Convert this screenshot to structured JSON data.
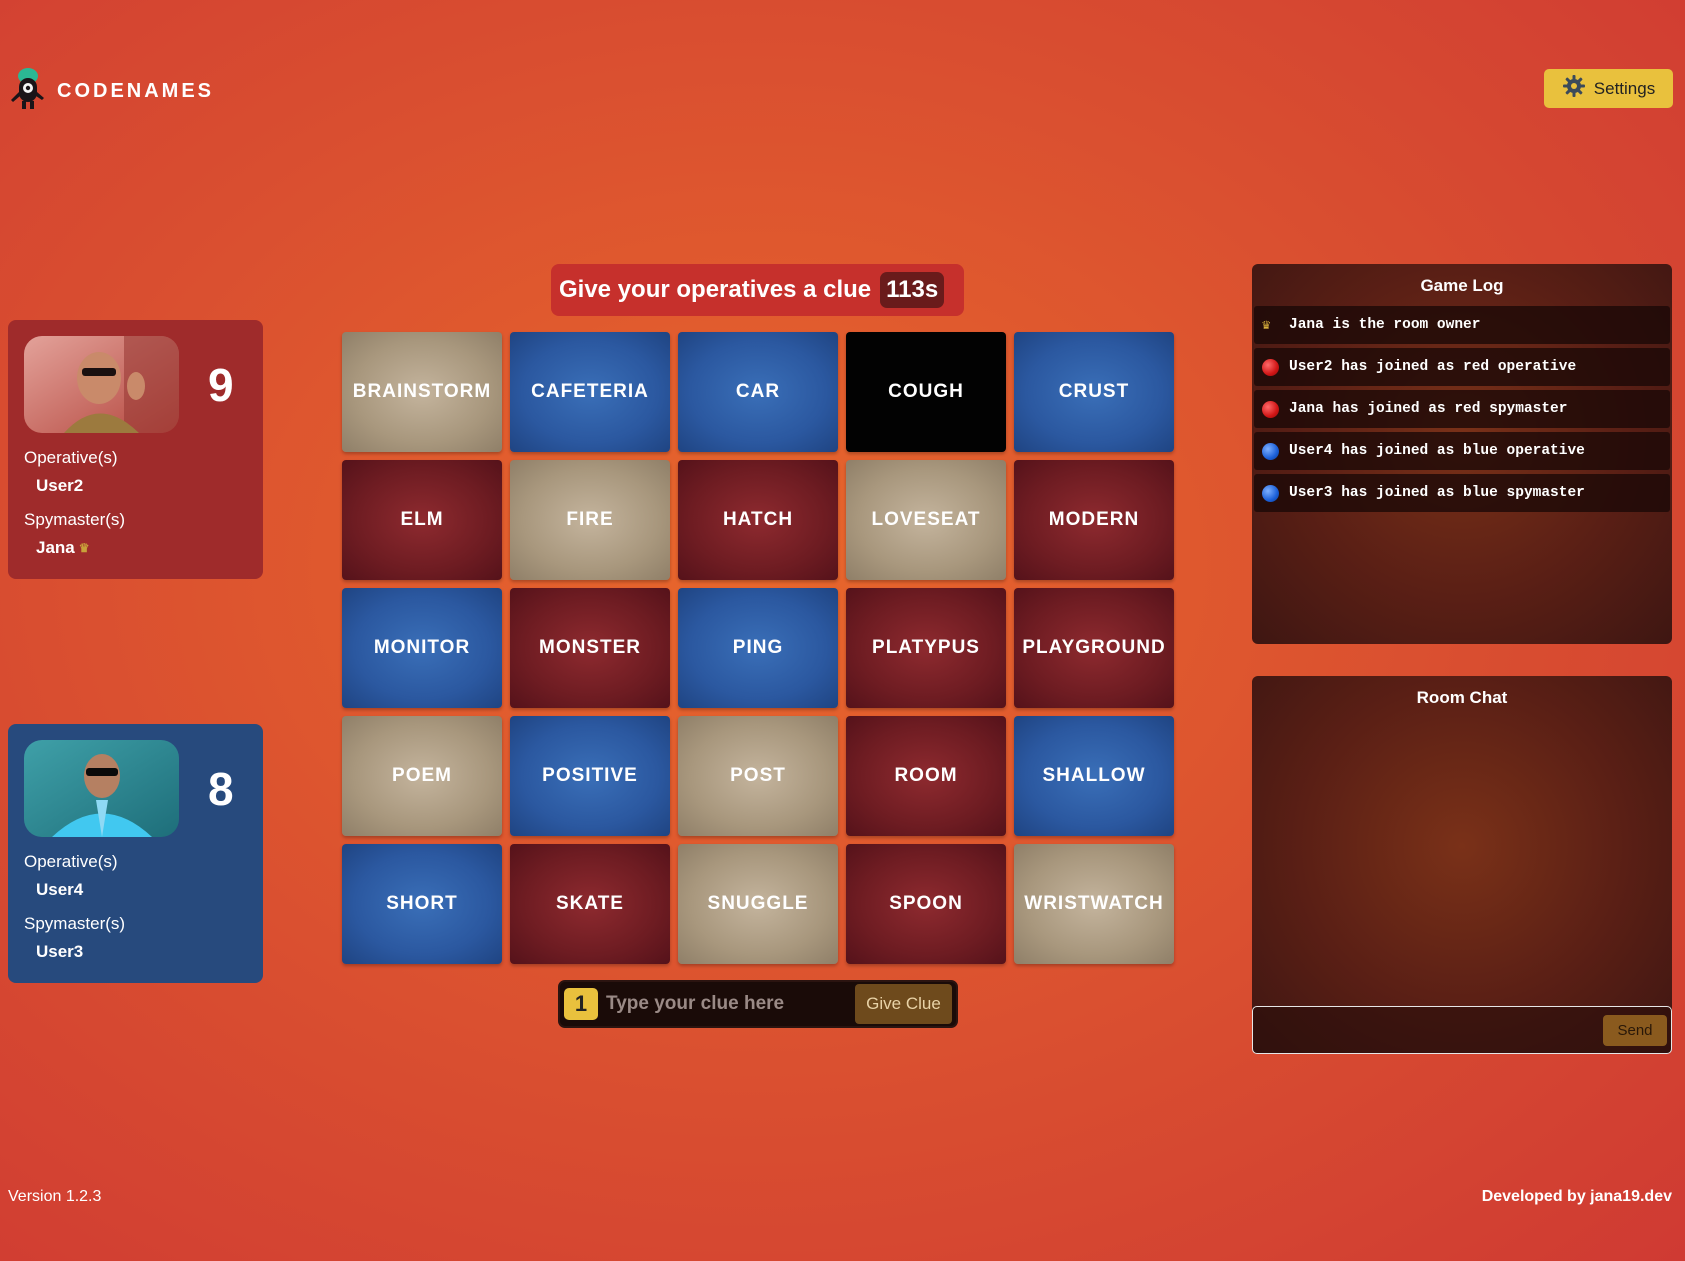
{
  "app": {
    "logo_text": "CODENAMES",
    "settings_label": "Settings"
  },
  "teams": {
    "red": {
      "score": "9",
      "operatives_label": "Operative(s)",
      "operatives": [
        "User2"
      ],
      "spymasters_label": "Spymaster(s)",
      "spymasters": [
        "Jana"
      ],
      "owner_badge_icon": "crown-icon",
      "color": "#9f2b2b"
    },
    "blue": {
      "score": "8",
      "operatives_label": "Operative(s)",
      "operatives": [
        "User4"
      ],
      "spymasters_label": "Spymaster(s)",
      "spymasters": [
        "User3"
      ],
      "color": "#274a7d"
    }
  },
  "turn": {
    "message": "Give your operatives a clue",
    "timer": "113s"
  },
  "board": {
    "cards": [
      {
        "word": "BRAINSTORM",
        "type": "neutral"
      },
      {
        "word": "CAFETERIA",
        "type": "blue"
      },
      {
        "word": "CAR",
        "type": "blue"
      },
      {
        "word": "COUGH",
        "type": "assassin"
      },
      {
        "word": "CRUST",
        "type": "blue"
      },
      {
        "word": "ELM",
        "type": "red"
      },
      {
        "word": "FIRE",
        "type": "neutral"
      },
      {
        "word": "HATCH",
        "type": "red"
      },
      {
        "word": "LOVESEAT",
        "type": "neutral"
      },
      {
        "word": "MODERN",
        "type": "red"
      },
      {
        "word": "MONITOR",
        "type": "blue"
      },
      {
        "word": "MONSTER",
        "type": "red"
      },
      {
        "word": "PING",
        "type": "blue"
      },
      {
        "word": "PLATYPUS",
        "type": "red"
      },
      {
        "word": "PLAYGROUND",
        "type": "red"
      },
      {
        "word": "POEM",
        "type": "neutral"
      },
      {
        "word": "POSITIVE",
        "type": "blue"
      },
      {
        "word": "POST",
        "type": "neutral"
      },
      {
        "word": "ROOM",
        "type": "red"
      },
      {
        "word": "SHALLOW",
        "type": "blue"
      },
      {
        "word": "SHORT",
        "type": "blue"
      },
      {
        "word": "SKATE",
        "type": "red"
      },
      {
        "word": "SNUGGLE",
        "type": "neutral"
      },
      {
        "word": "SPOON",
        "type": "red"
      },
      {
        "word": "WRISTWATCH",
        "type": "neutral"
      }
    ]
  },
  "clue": {
    "count": "1",
    "placeholder": "Type your clue here",
    "button_label": "Give Clue"
  },
  "game_log": {
    "title": "Game Log",
    "entries": [
      {
        "icon": "crown-icon",
        "text": "Jana is the room owner"
      },
      {
        "icon": "red-dot-icon",
        "text": "User2 has joined as red operative"
      },
      {
        "icon": "red-dot-icon",
        "text": "Jana has joined as red spymaster"
      },
      {
        "icon": "blue-dot-icon",
        "text": "User4 has joined as blue operative"
      },
      {
        "icon": "blue-dot-icon",
        "text": "User3 has joined as blue spymaster"
      }
    ]
  },
  "chat": {
    "title": "Room Chat",
    "input_value": "",
    "send_label": "Send"
  },
  "footer": {
    "version": "Version 1.2.3",
    "credit": "Developed by jana19.dev"
  }
}
